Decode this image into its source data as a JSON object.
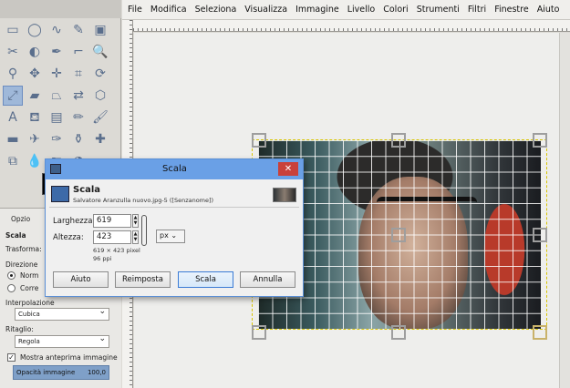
{
  "menubar": {
    "items": [
      "File",
      "Modifica",
      "Seleziona",
      "Visualizza",
      "Immagine",
      "Livello",
      "Colori",
      "Strumenti",
      "Filtri",
      "Finestre",
      "Aiuto"
    ]
  },
  "tools": [
    {
      "name": "rect-select-icon",
      "glyph": "▭"
    },
    {
      "name": "ellipse-select-icon",
      "glyph": "◯"
    },
    {
      "name": "free-select-icon",
      "glyph": "∿"
    },
    {
      "name": "fuzzy-select-icon",
      "glyph": "✎"
    },
    {
      "name": "color-select-icon",
      "glyph": "▣"
    },
    {
      "name": "scissors-select-icon",
      "glyph": "✂"
    },
    {
      "name": "foreground-select-icon",
      "glyph": "◐"
    },
    {
      "name": "paths-icon",
      "glyph": "✒"
    },
    {
      "name": "color-picker-icon",
      "glyph": "⌐"
    },
    {
      "name": "zoom-icon",
      "glyph": "🔍"
    },
    {
      "name": "measure-icon",
      "glyph": "⚲"
    },
    {
      "name": "move-icon",
      "glyph": "✥"
    },
    {
      "name": "align-icon",
      "glyph": "✛"
    },
    {
      "name": "crop-icon",
      "glyph": "⌗"
    },
    {
      "name": "rotate-icon",
      "glyph": "⟳"
    },
    {
      "name": "scale-icon",
      "glyph": "⤢"
    },
    {
      "name": "shear-icon",
      "glyph": "▰"
    },
    {
      "name": "perspective-icon",
      "glyph": "⏢"
    },
    {
      "name": "flip-icon",
      "glyph": "⇄"
    },
    {
      "name": "cage-icon",
      "glyph": "⬡"
    },
    {
      "name": "text-icon",
      "glyph": "A"
    },
    {
      "name": "bucket-fill-icon",
      "glyph": "⛾"
    },
    {
      "name": "blend-icon",
      "glyph": "▤"
    },
    {
      "name": "pencil-icon",
      "glyph": "✏"
    },
    {
      "name": "paintbrush-icon",
      "glyph": "🖌"
    },
    {
      "name": "eraser-icon",
      "glyph": "▬"
    },
    {
      "name": "airbrush-icon",
      "glyph": "✈"
    },
    {
      "name": "ink-icon",
      "glyph": "✑"
    },
    {
      "name": "clone-icon",
      "glyph": "⚱"
    },
    {
      "name": "heal-icon",
      "glyph": "✚"
    },
    {
      "name": "perspective-clone-icon",
      "glyph": "⧉"
    },
    {
      "name": "blur-icon",
      "glyph": "💧"
    },
    {
      "name": "smudge-icon",
      "glyph": "☛"
    },
    {
      "name": "dodge-burn-icon",
      "glyph": "◑"
    }
  ],
  "tool_options": {
    "tab_label": "Opzio",
    "title": "Scala",
    "transform_label": "Trasforma:",
    "direction_label": "Direzione",
    "radio_1": "Norm",
    "radio_2": "Corre",
    "interpolation_label": "Interpolazione",
    "interpolation_value": "Cubica",
    "clipping_label": "Ritaglio:",
    "clipping_value": "Regola",
    "preview_label": "Mostra anteprima immagine",
    "opacity_label": "Opacità immagine",
    "opacity_value": "100,0"
  },
  "dialog": {
    "title": "Scala",
    "close_glyph": "✕",
    "heading": "Scala",
    "subtitle": "Salvatore Aranzulla nuovo.jpg-5 ([Senzanome])",
    "width_label": "Larghezza:",
    "width_value": "619",
    "height_label": "Altezza:",
    "height_value": "423",
    "unit": "px",
    "size_info": "619 × 423 pixel",
    "resolution_info": "96 ppi",
    "buttons": {
      "help": "Aiuto",
      "reset": "Reimposta",
      "scale": "Scala",
      "cancel": "Annulla"
    }
  },
  "colors": {
    "titlebar": "#6aa0e6",
    "close": "#c9413a",
    "active_tool": "#9fb8d9"
  }
}
